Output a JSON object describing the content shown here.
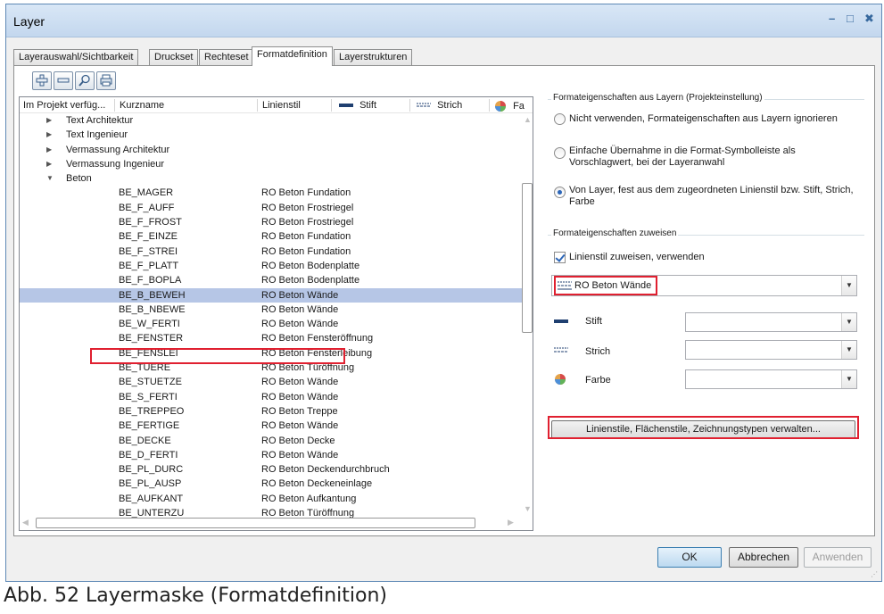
{
  "window": {
    "title": "Layer",
    "minimize": "–",
    "maximize": "□",
    "close": "✖"
  },
  "tabs": [
    "Layerauswahl/Sichtbarkeit",
    "Druckset",
    "Rechteset",
    "Formatdefinition",
    "Layerstrukturen"
  ],
  "active_tab": "Formatdefinition",
  "list": {
    "columns": [
      "Im Projekt verfüg...",
      "Kurzname",
      "Linienstil",
      "Stift",
      "Strich",
      "Fa"
    ],
    "groups": [
      "Text Architektur",
      "Text Ingenieur",
      "Vermassung Architektur",
      "Vermassung Ingenieur",
      "Beton"
    ],
    "rows": [
      {
        "kurzname": "BE_MAGER",
        "linienstil": "RO Beton Fundation"
      },
      {
        "kurzname": "BE_F_AUFF",
        "linienstil": "RO Beton Frostriegel"
      },
      {
        "kurzname": "BE_F_FROST",
        "linienstil": "RO Beton Frostriegel"
      },
      {
        "kurzname": "BE_F_EINZE",
        "linienstil": "RO Beton Fundation"
      },
      {
        "kurzname": "BE_F_STREI",
        "linienstil": "RO Beton Fundation"
      },
      {
        "kurzname": "BE_F_PLATT",
        "linienstil": "RO Beton Bodenplatte"
      },
      {
        "kurzname": "BE_F_BOPLA",
        "linienstil": "RO Beton Bodenplatte"
      },
      {
        "kurzname": "BE_B_BEWEH",
        "linienstil": "RO Beton Wände"
      },
      {
        "kurzname": "BE_B_NBEWE",
        "linienstil": "RO Beton Wände"
      },
      {
        "kurzname": "BE_W_FERTI",
        "linienstil": "RO Beton Wände"
      },
      {
        "kurzname": "BE_FENSTER",
        "linienstil": "RO Beton Fensteröffnung"
      },
      {
        "kurzname": "BE_FENSLEI",
        "linienstil": "RO Beton Fensterleibung"
      },
      {
        "kurzname": "BE_TUERE",
        "linienstil": "RO Beton Türöffnung"
      },
      {
        "kurzname": "BE_STUETZE",
        "linienstil": "RO Beton Wände"
      },
      {
        "kurzname": "BE_S_FERTI",
        "linienstil": "RO Beton Wände"
      },
      {
        "kurzname": "BE_TREPPEO",
        "linienstil": "RO Beton Treppe"
      },
      {
        "kurzname": "BE_FERTIGE",
        "linienstil": "RO Beton Wände"
      },
      {
        "kurzname": "BE_DECKE",
        "linienstil": "RO Beton Decke"
      },
      {
        "kurzname": "BE_D_FERTI",
        "linienstil": "RO Beton Wände"
      },
      {
        "kurzname": "BE_PL_DURC",
        "linienstil": "RO Beton Deckendurchbruch"
      },
      {
        "kurzname": "BE_PL_AUSP",
        "linienstil": "RO Beton Deckeneinlage"
      },
      {
        "kurzname": "BE_AUFKANT",
        "linienstil": "RO Beton Aufkantung"
      },
      {
        "kurzname": "BE_UNTERZU",
        "linienstil": "RO Beton Türöffnung"
      }
    ],
    "selected_row": "BE_B_BEWEH"
  },
  "right": {
    "group1_title": "Formateigenschaften aus Layern (Projekteinstellung)",
    "radio1": "Nicht verwenden, Formateigenschaften aus Layern ignorieren",
    "radio2": "Einfache Übernahme in die Format-Symbolleiste als Vorschlagwert, bei der Layeranwahl",
    "radio3": "Von Layer, fest aus dem zugeordneten Linienstil bzw. Stift, Strich, Farbe",
    "group2_title": "Formateigenschaften zuweisen",
    "checkbox": "Linienstil zuweisen, verwenden",
    "linestyle_value": "RO Beton Wände",
    "stift_label": "Stift",
    "strich_label": "Strich",
    "farbe_label": "Farbe",
    "manage_button": "Linienstile, Flächenstile, Zeichnungstypen verwalten..."
  },
  "buttons": {
    "ok": "OK",
    "cancel": "Abbrechen",
    "apply": "Anwenden"
  },
  "caption": "Abb. 52   Layermaske (Formatdefinition)",
  "colors": {
    "highlight": "#e02030",
    "selection": "#b6c6e6",
    "accent": "#2c66b8"
  }
}
